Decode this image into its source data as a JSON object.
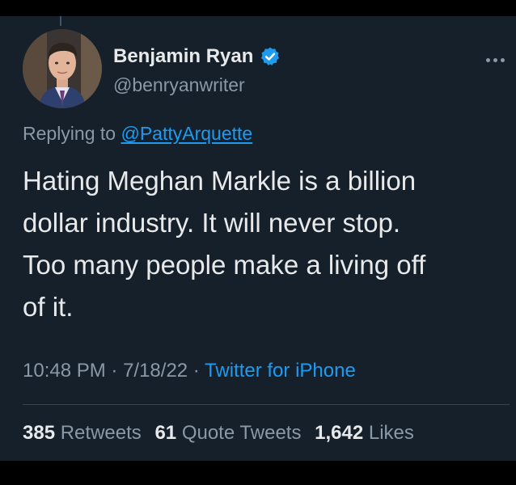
{
  "tweet": {
    "author": {
      "display_name": "Benjamin Ryan",
      "handle": "@benryanwriter",
      "verified_icon": "verified-badge-icon"
    },
    "more_icon": "more-options-icon",
    "reply": {
      "prefix": "Replying to",
      "target": "@PattyArquette"
    },
    "text_lines": [
      "Hating Meghan Markle is a billion",
      "dollar industry. It will never stop.",
      "Too many people make a living off",
      "of it."
    ],
    "meta": {
      "time": "10:48 PM",
      "separator": " · ",
      "date": "7/18/22",
      "source": "Twitter for iPhone"
    },
    "stats": {
      "retweets_count": "385",
      "retweets_label": "Retweets",
      "quote_count": "61",
      "quote_label": "Quote Tweets",
      "likes_count": "1,642",
      "likes_label": "Likes"
    },
    "colors": {
      "background": "#15202b",
      "accent": "#1d9bf0",
      "secondary_text": "#8b98a5",
      "primary_text": "#e7e9ea"
    }
  }
}
